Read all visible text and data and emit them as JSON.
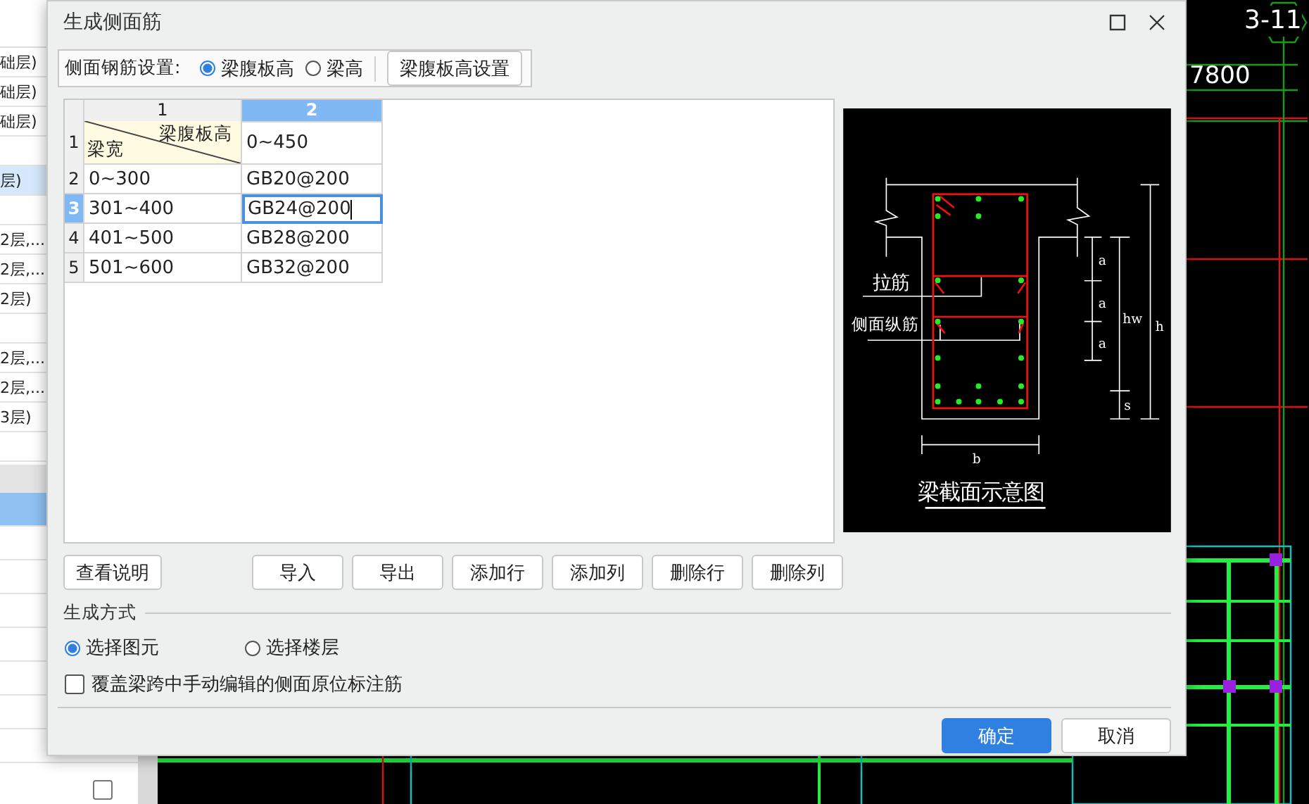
{
  "background": {
    "side_list": {
      "rows": [
        {
          "label": "础层)",
          "selected": false
        },
        {
          "label": "础层)",
          "selected": false
        },
        {
          "label": "础层)",
          "selected": false
        },
        {
          "selected": false
        },
        {
          "label": "层)",
          "selected": true
        },
        {
          "selected": false
        },
        {
          "label": "2层,...",
          "selected": false
        },
        {
          "label": "2层,...",
          "selected": false
        },
        {
          "label": "2层)",
          "selected": false
        },
        {
          "selected": false
        },
        {
          "label": "2层,...",
          "selected": false
        },
        {
          "label": "2层,...",
          "selected": false
        },
        {
          "label": "3层)",
          "selected": false
        },
        {
          "selected": false
        }
      ],
      "lower_rows": [
        {
          "selected": true
        },
        {
          "selected": false
        },
        {
          "selected": false
        },
        {
          "selected": false
        },
        {
          "selected": false
        },
        {
          "selected": false
        },
        {
          "selected": false
        },
        {
          "selected": false
        }
      ],
      "checkbox": {
        "checked": false
      }
    },
    "cad": {
      "grid_label": "3-11",
      "dimension": "7800"
    }
  },
  "dialog": {
    "title": "生成侧面筋",
    "setting": {
      "label": "侧面钢筋设置:",
      "options": [
        {
          "label": "梁腹板高",
          "selected": true
        },
        {
          "label": "梁高",
          "selected": false
        }
      ],
      "button": "梁腹板高设置"
    },
    "table": {
      "columns": [
        {
          "label": "1",
          "selected": false
        },
        {
          "label": "2",
          "selected": true
        }
      ],
      "header_row": {
        "number": "1",
        "corner_top": "梁腹板高",
        "corner_bottom": "梁宽",
        "value": "0~450",
        "selected": false
      },
      "rows": [
        {
          "number": "2",
          "width": "0~300",
          "rebar": "GB20@200",
          "selected": false
        },
        {
          "number": "3",
          "width": "301~400",
          "rebar": "GB24@200",
          "selected": true
        },
        {
          "number": "4",
          "width": "401~500",
          "rebar": "GB28@200",
          "selected": false
        },
        {
          "number": "5",
          "width": "501~600",
          "rebar": "GB32@200",
          "selected": false
        }
      ]
    },
    "diagram": {
      "tie_label": "拉筋",
      "side_label": "侧面纵筋",
      "spacing_labels": [
        "a",
        "a",
        "a"
      ],
      "web_label": "hw",
      "height_label": "h",
      "cover_label": "s",
      "width_label": "b",
      "caption": "梁截面示意图"
    },
    "help_button": "查看说明",
    "table_buttons": [
      "导入",
      "导出",
      "添加行",
      "添加列",
      "删除行",
      "删除列"
    ],
    "method": {
      "title": "生成方式",
      "options": [
        {
          "label": "选择图元",
          "selected": true
        },
        {
          "label": "选择楼层",
          "selected": false
        }
      ]
    },
    "override": {
      "label": "覆盖梁跨中手动编辑的侧面原位标注筋",
      "checked": false
    },
    "buttons": [
      {
        "label": "确定",
        "kind": "primary"
      },
      {
        "label": "取消",
        "kind": "secondary"
      }
    ]
  }
}
